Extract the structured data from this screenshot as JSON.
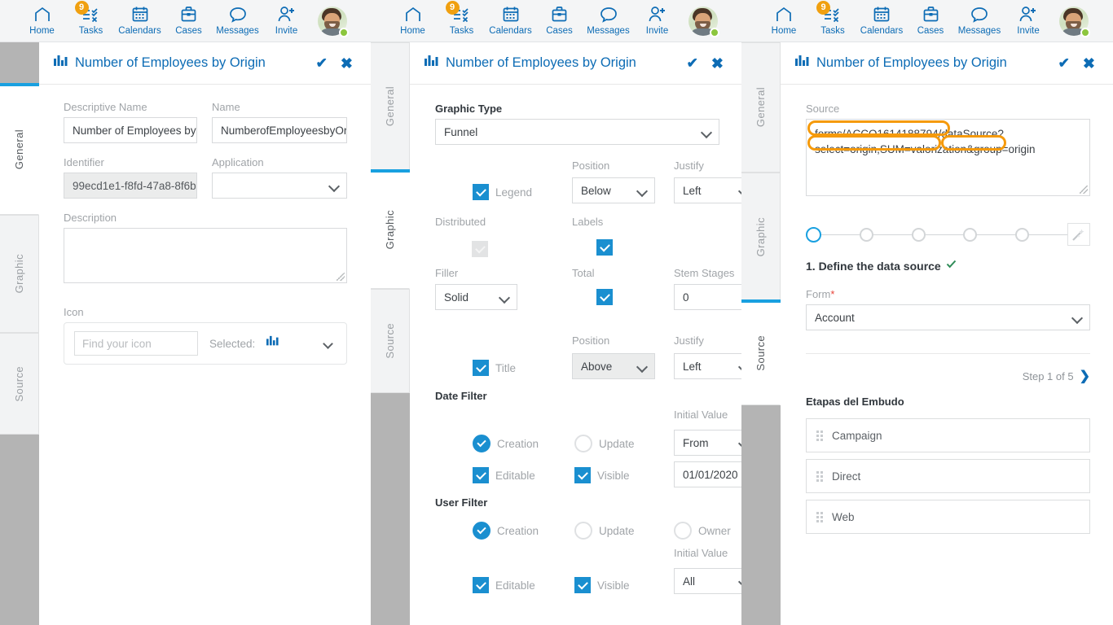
{
  "nav": {
    "items": [
      {
        "label": "Home",
        "icon": "home-icon",
        "badge": null
      },
      {
        "label": "Tasks",
        "icon": "tasks-icon",
        "badge": "9"
      },
      {
        "label": "Calendars",
        "icon": "calendar-icon",
        "badge": null
      },
      {
        "label": "Cases",
        "icon": "briefcase-icon",
        "badge": null
      },
      {
        "label": "Messages",
        "icon": "chat-icon",
        "badge": null
      },
      {
        "label": "Invite",
        "icon": "user-plus-icon",
        "badge": null
      }
    ],
    "avatar_status": "online"
  },
  "colors": {
    "brand_blue": "#0d6cb5",
    "accent_blue": "#19a0e0",
    "checkbox_blue": "#1a8fd0",
    "badge_orange": "#f0a010",
    "highlight_orange": "#f59a0b",
    "status_green": "#8cc63e",
    "gray_strip": "#b4b4b4"
  },
  "panels": [
    {
      "title": "Number of Employees by Origin",
      "title_icon": "bar-chart-icon",
      "confirm_icon": "check-icon",
      "close_icon": "close-icon",
      "tabs": [
        {
          "label": "General",
          "active": true
        },
        {
          "label": "Graphic",
          "active": false
        },
        {
          "label": "Source",
          "active": false
        }
      ]
    },
    {
      "title": "Number of Employees by Origin",
      "title_icon": "bar-chart-icon",
      "confirm_icon": "check-icon",
      "close_icon": "close-icon",
      "tabs": [
        {
          "label": "General",
          "active": false
        },
        {
          "label": "Graphic",
          "active": true
        },
        {
          "label": "Source",
          "active": false
        }
      ]
    },
    {
      "title": "Number of Employees by Origin",
      "title_icon": "bar-chart-icon",
      "confirm_icon": "check-icon",
      "close_icon": "close-icon",
      "tabs": [
        {
          "label": "General",
          "active": false
        },
        {
          "label": "Graphic",
          "active": false
        },
        {
          "label": "Source",
          "active": true
        }
      ]
    }
  ],
  "general": {
    "descriptive_name_label": "Descriptive Name",
    "descriptive_name_value": "Number of Employees by",
    "name_label": "Name",
    "name_value": "NumberofEmployeesbyOr",
    "identifier_label": "Identifier",
    "identifier_value": "99ecd1e1-f8fd-47a8-8f6b-",
    "application_label": "Application",
    "application_value": "",
    "description_label": "Description",
    "description_value": "",
    "icon_label": "Icon",
    "icon_search_placeholder": "Find your icon",
    "icon_selected_label": "Selected:",
    "icon_selected_glyph": "bar-chart-icon"
  },
  "graphic": {
    "graphic_type_label": "Graphic Type",
    "graphic_type_value": "Funnel",
    "legend_label": "Legend",
    "legend_checked": true,
    "legend_position_label": "Position",
    "legend_position_value": "Below",
    "legend_justify_label": "Justify",
    "legend_justify_value": "Left",
    "distributed_label": "Distributed",
    "distributed_checked": false,
    "labels_label": "Labels",
    "labels_checked": true,
    "filler_label": "Filler",
    "filler_value": "Solid",
    "total_label": "Total",
    "total_checked": true,
    "stem_stages_label": "Stem Stages",
    "stem_stages_value": "0",
    "title_label": "Title",
    "title_checked": true,
    "title_position_label": "Position",
    "title_position_value": "Above",
    "title_justify_label": "Justify",
    "title_justify_value": "Left",
    "date_filter_label": "Date Filter",
    "date_creation_label": "Creation",
    "date_creation_selected": true,
    "date_update_label": "Update",
    "date_update_selected": false,
    "date_initial_value_label": "Initial Value",
    "date_initial_value": "From",
    "date_value": "01/01/2020",
    "date_editable_label": "Editable",
    "date_editable_checked": true,
    "date_visible_label": "Visible",
    "date_visible_checked": true,
    "user_filter_label": "User Filter",
    "user_creation_label": "Creation",
    "user_creation_selected": true,
    "user_update_label": "Update",
    "user_update_selected": false,
    "user_owner_label": "Owner",
    "user_owner_selected": false,
    "user_initial_value_label": "Initial Value",
    "user_initial_value": "All",
    "user_editable_label": "Editable",
    "user_editable_checked": true,
    "user_visible_label": "Visible",
    "user_visible_checked": true
  },
  "source": {
    "source_label": "Source",
    "source_value": "forms/ACCO1614188794/dataSource?select=origin,SUM=valorization&group=origin",
    "source_line1": "forms/ACCO1614188794/dataSource",
    "source_line1_tail": "?",
    "source_line2a": "select=origin,SUM=valorization",
    "source_line2_sep": "&",
    "source_line2b": "group=origin",
    "wizard_steps": 5,
    "wizard_active_step": 1,
    "wand_icon": "magic-wand-icon",
    "step_title": "1. Define the data source",
    "step_done_icon": "check-icon",
    "form_label": "Form",
    "form_required_mark": "*",
    "form_value": "Account",
    "step_nav_text": "Step 1 of 5",
    "step_nav_icon": "chevron-right-icon",
    "stages_title": "Etapas del Embudo",
    "stages": [
      {
        "label": "Campaign"
      },
      {
        "label": "Direct"
      },
      {
        "label": "Web"
      }
    ]
  }
}
